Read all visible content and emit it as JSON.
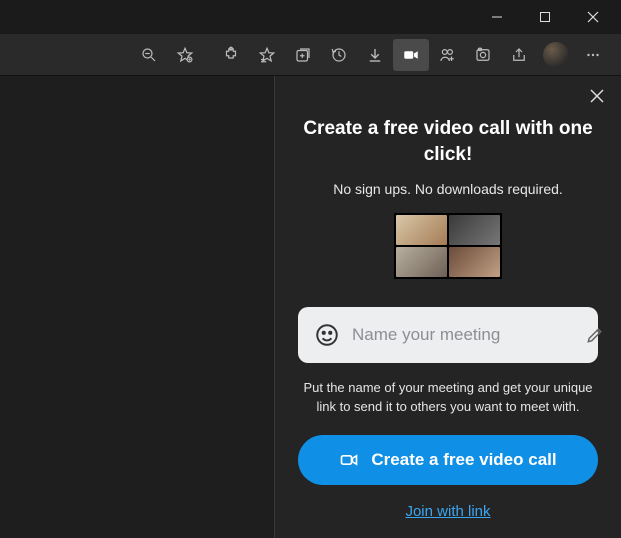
{
  "window_controls": {
    "minimize": "minimize",
    "maximize": "maximize",
    "close": "close"
  },
  "toolbar": {
    "icons": [
      "zoom-out-icon",
      "favorite-star-icon",
      "extensions-icon",
      "favorites-list-icon",
      "collections-icon",
      "history-icon",
      "download-icon",
      "video-call-icon",
      "performance-icon",
      "web-capture-icon",
      "share-icon"
    ],
    "active_icon": "video-call-icon",
    "more": "settings-and-more"
  },
  "panel": {
    "close_label": "Close",
    "title": "Create a free video call with one click!",
    "subtitle": "No sign ups. No downloads required.",
    "input_placeholder": "Name your meeting",
    "helper_text": "Put the name of your meeting and get your unique link to send it to others you want to meet with.",
    "cta_label": "Create a free video call",
    "join_link_label": "Join with link",
    "colors": {
      "accent": "#0f8fe6",
      "link": "#3aa6f2"
    }
  }
}
